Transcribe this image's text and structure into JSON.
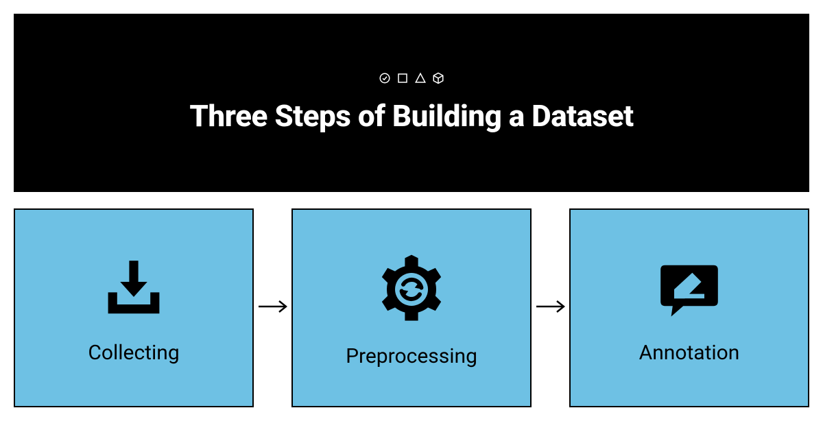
{
  "header": {
    "title": "Three Steps of Building a Dataset",
    "icons": [
      "check-circle",
      "square",
      "triangle",
      "cube"
    ]
  },
  "steps": [
    {
      "label": "Collecting",
      "icon": "download-tray"
    },
    {
      "label": "Preprocessing",
      "icon": "gear-refresh"
    },
    {
      "label": "Annotation",
      "icon": "chat-edit"
    }
  ],
  "colors": {
    "step_bg": "#6EC1E4",
    "header_bg": "#000000",
    "text": "#000000"
  }
}
